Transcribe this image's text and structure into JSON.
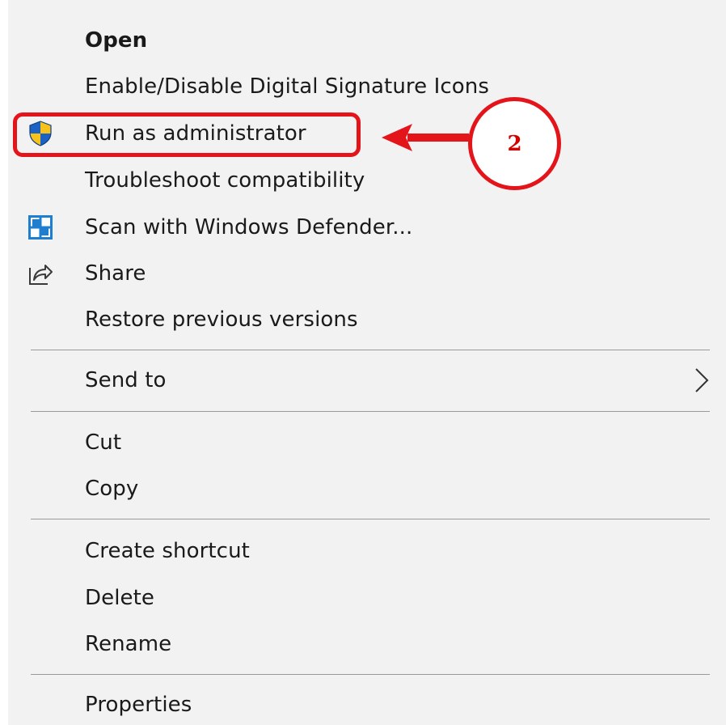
{
  "menu": {
    "open": "Open",
    "signature_icons": "Enable/Disable Digital Signature Icons",
    "run_as_admin": "Run as administrator",
    "troubleshoot": "Troubleshoot compatibility",
    "scan_defender": "Scan with Windows Defender...",
    "share": "Share",
    "restore_versions": "Restore previous versions",
    "send_to": "Send to",
    "cut": "Cut",
    "copy": "Copy",
    "create_shortcut": "Create shortcut",
    "delete": "Delete",
    "rename": "Rename",
    "properties": "Properties"
  },
  "annotation": {
    "step_number": "2",
    "highlight_color": "#e4141b"
  },
  "icons": {
    "run_as_admin": "uac-shield-icon",
    "scan_defender": "windows-defender-icon",
    "share": "share-icon",
    "send_to": "chevron-right-icon"
  }
}
